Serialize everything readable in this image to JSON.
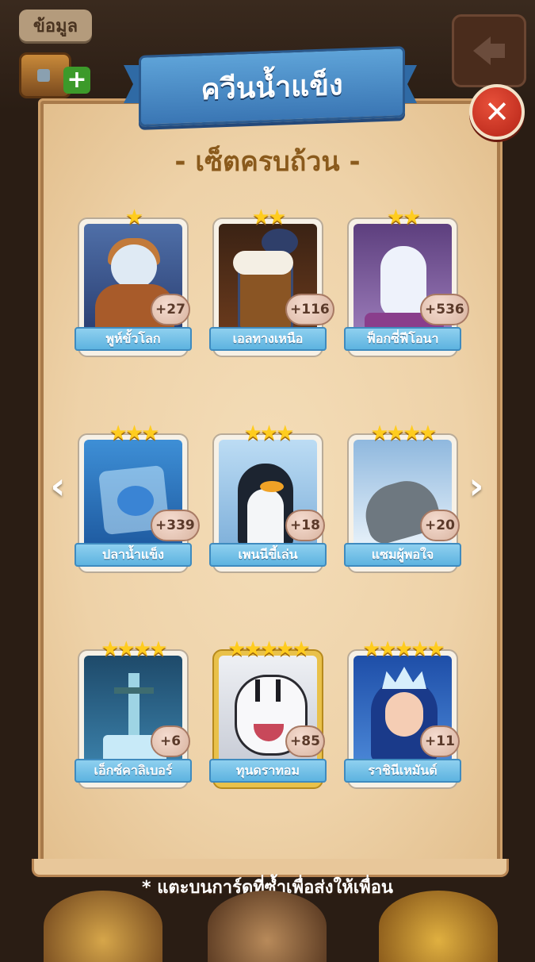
{
  "header": {
    "info_label": "ข้อมูล",
    "title": "ควีนน้ำแข็ง",
    "subtitle": "- เซ็ตครบถ้วน -"
  },
  "icons": {
    "close": "close-icon",
    "back": "back-arrow-icon",
    "chest": "chest-icon",
    "plus": "plus-icon",
    "prev": "chevron-left-icon",
    "next": "chevron-right-icon"
  },
  "cards": [
    {
      "name": "พูห์ขั้วโลก",
      "stars": "★",
      "count": "+27",
      "gold": false
    },
    {
      "name": "เอลทางเหนือ",
      "stars": "★★",
      "count": "+116",
      "gold": false
    },
    {
      "name": "ฟ็อกซี่ฟีโอนา",
      "stars": "★★",
      "count": "+536",
      "gold": false
    },
    {
      "name": "ปลาน้ำแข็ง",
      "stars": "★★★",
      "count": "+339",
      "gold": false
    },
    {
      "name": "เพนนีขี้เล่น",
      "stars": "★★★",
      "count": "+18",
      "gold": false
    },
    {
      "name": "แซมผู้พอใจ",
      "stars": "★★★★",
      "count": "+20",
      "gold": false
    },
    {
      "name": "เอ็กซ์คาลิเบอร์",
      "stars": "★★★★",
      "count": "+6",
      "gold": false
    },
    {
      "name": "ทุนดราทอม",
      "stars": "★★★★★",
      "count": "+85",
      "gold": true
    },
    {
      "name": "ราชินีเหมันต์",
      "stars": "★★★★★",
      "count": "+11",
      "gold": false
    }
  ],
  "nav": {
    "prev": "‹",
    "next": "›"
  },
  "footnote": "* แตะบนการ์ดที่ซ้ำเพื่อส่งให้เพื่อน",
  "colors": {
    "parchment": "#eed2a8",
    "ribbon": "#3a76b4",
    "close": "#d23a26",
    "label": "#5db3e0",
    "star": "#ffcc1e"
  }
}
